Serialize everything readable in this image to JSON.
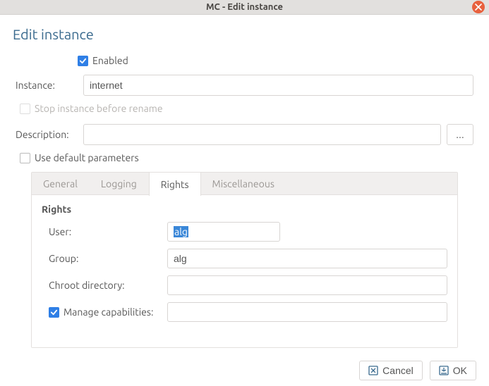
{
  "window": {
    "title": "MC - Edit instance"
  },
  "heading": "Edit instance",
  "form": {
    "enabled": {
      "label": "Enabled",
      "checked": true
    },
    "instance": {
      "label": "Instance:",
      "value": "internet"
    },
    "stopBeforeRename": {
      "label": "Stop instance before rename",
      "checked": false,
      "disabled": true
    },
    "description": {
      "label": "Description:",
      "value": "",
      "browse": "..."
    },
    "useDefaultParams": {
      "label": "Use default parameters",
      "checked": false
    }
  },
  "tabs": {
    "general": "General",
    "logging": "Logging",
    "rights": "Rights",
    "miscellaneous": "Miscellaneous",
    "active": "rights"
  },
  "rights": {
    "title": "Rights",
    "user": {
      "label": "User:",
      "value": "alg"
    },
    "group": {
      "label": "Group:",
      "value": "alg"
    },
    "chroot": {
      "label": "Chroot directory:",
      "value": ""
    },
    "manageCaps": {
      "label": "Manage capabilities:",
      "checked": true,
      "value": ""
    }
  },
  "buttons": {
    "cancel": "Cancel",
    "ok": "OK"
  }
}
